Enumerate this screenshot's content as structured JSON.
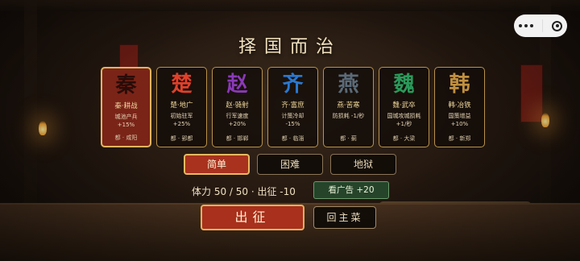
{
  "title": "择国而治",
  "states": [
    {
      "glyph": "秦",
      "color": "#2a0c08",
      "trait": "秦·耕战",
      "desc": "城池产兵\n+15%",
      "capital": "都 · 咸阳",
      "selected": true
    },
    {
      "glyph": "楚",
      "color": "#e0402a",
      "trait": "楚·地广",
      "desc": "初始驻军\n+25%",
      "capital": "都 · 郢都",
      "selected": false
    },
    {
      "glyph": "赵",
      "color": "#8a3ab8",
      "trait": "赵·骑射",
      "desc": "行军速度\n+20%",
      "capital": "都 · 邯郸",
      "selected": false
    },
    {
      "glyph": "齐",
      "color": "#2a78d0",
      "trait": "齐·富庶",
      "desc": "计策冷却\n-15%",
      "capital": "都 · 临淄",
      "selected": false
    },
    {
      "glyph": "燕",
      "color": "#5a6a78",
      "trait": "燕·苦寒",
      "desc": "防损耗 -1/秒",
      "capital": "都 · 蓟",
      "selected": false
    },
    {
      "glyph": "魏",
      "color": "#2a9a5a",
      "trait": "魏·武卒",
      "desc": "国城攻城损耗 +1/秒",
      "capital": "都 · 大梁",
      "selected": false
    },
    {
      "glyph": "韩",
      "color": "#c09040",
      "trait": "韩·冶铁",
      "desc": "国策增益\n+10%",
      "capital": "都 · 新郑",
      "selected": false
    }
  ],
  "difficulties": [
    {
      "label": "简单",
      "active": true
    },
    {
      "label": "困难",
      "active": false
    },
    {
      "label": "地狱",
      "active": false
    }
  ],
  "stamina_text": "体力 50 / 50 · 出征 -10",
  "ad_button": "看广告 +20",
  "start_button": "出征",
  "menu_button": "回主菜",
  "capsule": {
    "more_icon": "more-dots-icon",
    "close_icon": "target-close-icon"
  }
}
